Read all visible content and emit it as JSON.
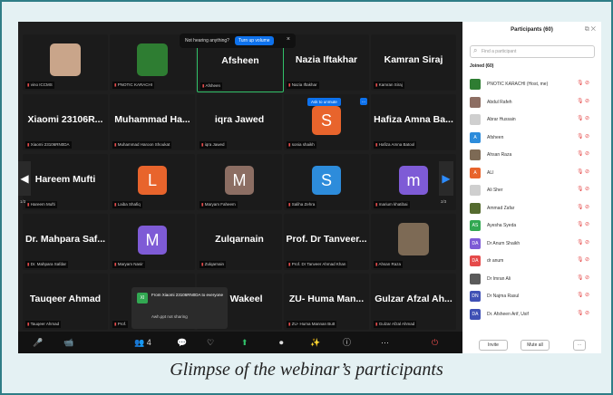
{
  "caption": "Glimpse of the webinar’s participants",
  "toast": {
    "text": "Not hearing anything?",
    "button": "Turn up volume",
    "close": "×"
  },
  "tiles": [
    {
      "name": "",
      "sub": "vino ICCMS",
      "avatar": "photo",
      "avatar_color": "#c9a58a"
    },
    {
      "name": "",
      "sub": "PNOTIC KARACHI",
      "avatar": "logo",
      "avatar_color": "#2e7d32"
    },
    {
      "name": "Afsheen",
      "sub": "Afsheen",
      "highlight": true
    },
    {
      "name": "Nazia Iftakhar",
      "sub": "Nazia Iftakhar"
    },
    {
      "name": "Kamran Siraj",
      "sub": "Kamran Siraj"
    },
    {
      "name": "Xiaomi 23106R...",
      "sub": "Xiaomi 23106RN0DA"
    },
    {
      "name": "Muhammad Ha...",
      "sub": "Muhammad Haroon Shoukat"
    },
    {
      "name": "iqra Jawed",
      "sub": "iqra Jawed"
    },
    {
      "name": "",
      "sub": "sonia shaikh",
      "avatar": "S",
      "avatar_color": "#e8642c"
    },
    {
      "name": "Hafiza Amna Ba...",
      "sub": "Hafiza Amna Batool"
    },
    {
      "name": "Hareem Mufti",
      "sub": "Hareem Mufti"
    },
    {
      "name": "",
      "sub": "Laiba Shafiq",
      "avatar": "L",
      "avatar_color": "#e8642c"
    },
    {
      "name": "",
      "sub": "Maryam Faheem",
      "avatar": "M",
      "avatar_color": "#8c6e63"
    },
    {
      "name": "",
      "sub": "Saliha Zehra",
      "avatar": "S",
      "avatar_color": "#2d8cdb"
    },
    {
      "name": "",
      "sub": "marium khatibai",
      "avatar": "m",
      "avatar_color": "#7e5bd6"
    },
    {
      "name": "Dr. Mahpara Saf...",
      "sub": "Dr. Mahpara Safdar"
    },
    {
      "name": "",
      "sub": "Maryam Nasir",
      "avatar": "M",
      "avatar_color": "#7e5bd6"
    },
    {
      "name": "Zulqarnain",
      "sub": "Zulqarnain"
    },
    {
      "name": "Prof. Dr Tanveer...",
      "sub": "Prof. Dr Tanveer Ahmad Khan"
    },
    {
      "name": "",
      "sub": "Ahsan Raza",
      "avatar": "photo",
      "avatar_color": "#7d6a55"
    },
    {
      "name": "Tauqeer Ahmad",
      "sub": "Tauqeer Ahmad"
    },
    {
      "name": "Pro",
      "sub": "Prof."
    },
    {
      "name": "an Wakeel",
      "sub": ""
    },
    {
      "name": "ZU- Huma Man...",
      "sub": "ZU- Huma Mannan Butt"
    },
    {
      "name": "Gulzar Afzal Ah...",
      "sub": "Gulzar Afzal Ahmad"
    }
  ],
  "rename": {
    "label": "Ask to unmute",
    "more": "..."
  },
  "page_left": "1/3",
  "page_right": "2/3",
  "chat": {
    "avatar": "XI",
    "title": "From Xiaomi 23106RN0DA to everyone",
    "message": "Awh.ppt not sharing"
  },
  "toolbar": [
    "🎤",
    "📹",
    "👥 4",
    "💬",
    "♡",
    "⬆",
    "⏺",
    "✨",
    "ⓘ",
    "⋯",
    "⏻"
  ],
  "panel": {
    "title": "Participants (60)",
    "search_placeholder": "Find a participant",
    "joined_label": "Joined (60)",
    "rows": [
      {
        "name": "PNOTIC KARACHI (Host, me)",
        "initials": "",
        "color": "#2e7d32"
      },
      {
        "name": "Abdul Rafeh",
        "initials": "",
        "color": "#8d6e63"
      },
      {
        "name": "Abrar Hussain",
        "initials": "",
        "color": "#cfcfcf"
      },
      {
        "name": "Afsheen",
        "initials": "A",
        "color": "#2d8cdb"
      },
      {
        "name": "Ahsan Raza",
        "initials": "",
        "color": "#7d6a55"
      },
      {
        "name": "ALI",
        "initials": "A",
        "color": "#e8642c"
      },
      {
        "name": "Ali Sher",
        "initials": "",
        "color": "#cfcfcf"
      },
      {
        "name": "Ammad Zafar",
        "initials": "",
        "color": "#556b2f"
      },
      {
        "name": "Ayesha Syeda",
        "initials": "AS",
        "color": "#32a852"
      },
      {
        "name": "Dr Anum Shaikh",
        "initials": "DA",
        "color": "#7e5bd6"
      },
      {
        "name": "dr anum",
        "initials": "DA",
        "color": "#e54b4b"
      },
      {
        "name": "Dr Imran Ali",
        "initials": "",
        "color": "#5a5a5a"
      },
      {
        "name": "Dr Najma Rasul",
        "initials": "DN",
        "color": "#3f51b5"
      },
      {
        "name": "Dr. Afsheen Arif, Usif",
        "initials": "DA",
        "color": "#3f51b5"
      }
    ],
    "invite": "Invite",
    "mute_all": "Mute all",
    "more": "⋯"
  }
}
